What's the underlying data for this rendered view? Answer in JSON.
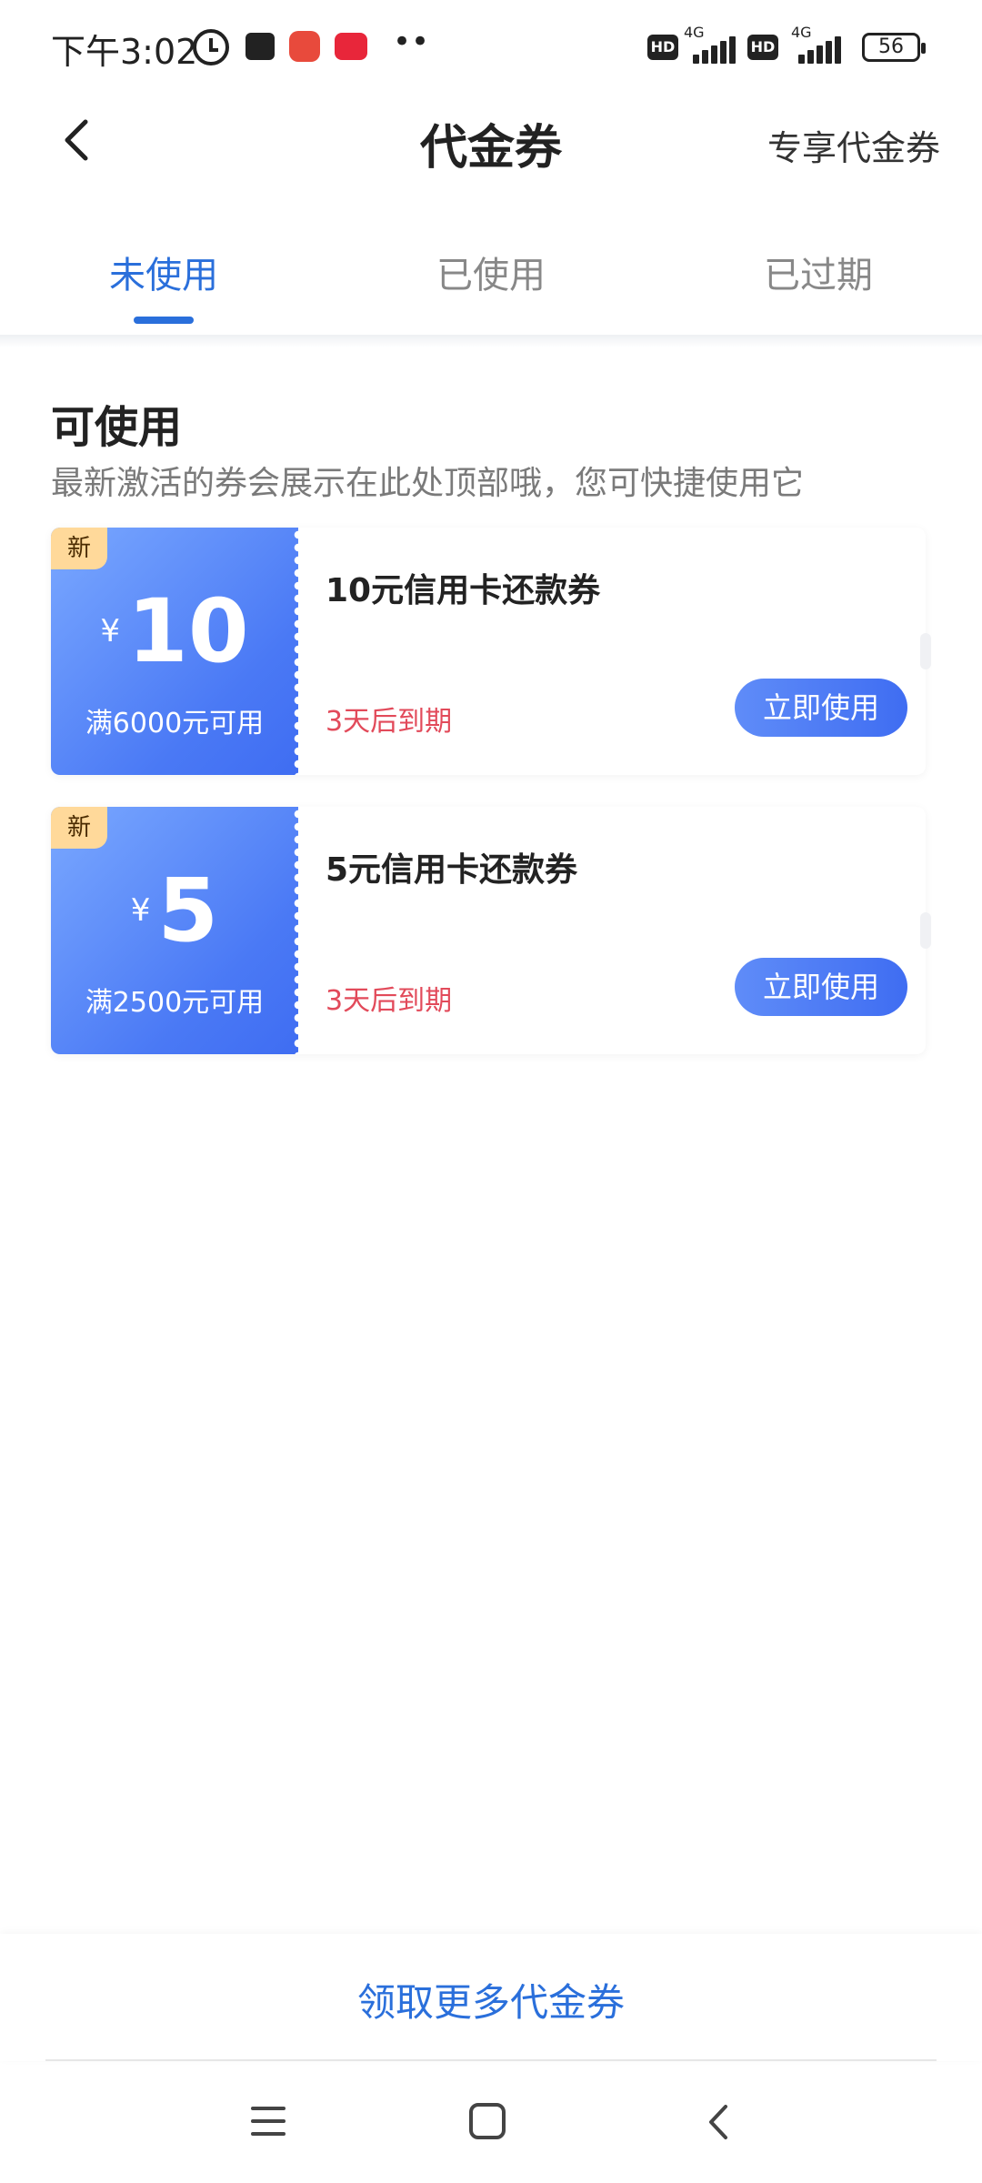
{
  "status_bar": {
    "time": "下午3:02",
    "dots": "••",
    "hd": "HD",
    "network": "4G",
    "battery": "56"
  },
  "header": {
    "back_icon": "chevron-left-icon",
    "title": "代金券",
    "right_link": "专享代金券"
  },
  "tabs": [
    {
      "label": "未使用",
      "active": true
    },
    {
      "label": "已使用",
      "active": false
    },
    {
      "label": "已过期",
      "active": false
    }
  ],
  "section": {
    "title": "可使用",
    "subtitle": "最新激活的券会展示在此处顶部哦，您可快捷使用它"
  },
  "coupons": [
    {
      "tag": "新",
      "currency": "¥",
      "amount": "10",
      "condition": "满6000元可用",
      "name": "10元信用卡还款券",
      "expiry": "3天后到期",
      "button": "立即使用"
    },
    {
      "tag": "新",
      "currency": "¥",
      "amount": "5",
      "condition": "满2500元可用",
      "name": "5元信用卡还款券",
      "expiry": "3天后到期",
      "button": "立即使用"
    }
  ],
  "footer": {
    "more_link": "领取更多代金券"
  },
  "colors": {
    "accent": "#2a6fdb",
    "coupon_gradient_start": "#7aa8ff",
    "coupon_gradient_end": "#3f6df2",
    "expiry": "#e24a5a",
    "new_tag": "#ffd99a"
  }
}
